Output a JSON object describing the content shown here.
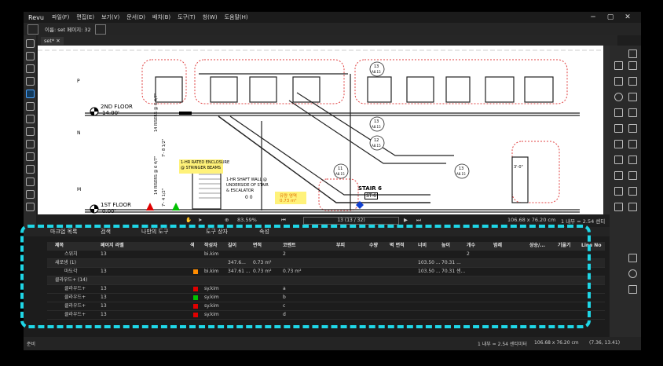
{
  "titlebar": {
    "app": "Revu",
    "menu": [
      "파일(F)",
      "편집(E)",
      "보기(V)",
      "문서(D)",
      "배치(B)",
      "도구(T)",
      "창(W)",
      "도움말(H)"
    ],
    "ctl": [
      "−",
      "▢",
      "✕"
    ]
  },
  "toolbar": {
    "label": "이름: set  페이지: 32"
  },
  "tab": {
    "label": "set*",
    "close": "✕"
  },
  "drawing": {
    "floor2": "2ND FLOOR",
    "floor2_elev": "14.00'",
    "floor1": "1ST FLOOR",
    "floor1_elev": "0.00'",
    "risers1": "14 RISERS @ 6 4/7\"",
    "risers2": "14 RISERS @ 6 4/7\"",
    "dim1": "7'- 8 1/2\"",
    "dim2": "7'- 4 1/2\"",
    "note1a": "1-HR RATED ENCLOSURE",
    "note1b": "@ STRINGER BEAMS",
    "note2a": "1-HR SHAFT WALL @",
    "note2b": "UNDERSIDE OF STAIR",
    "note2c": "& ESCALATOR",
    "area_label": "유량 영역",
    "area_value": "0.73 m²",
    "stair": "STAIR 6",
    "stair_tag": "ST-6",
    "bubbles": [
      {
        "n": "13",
        "s": "A8.15"
      },
      {
        "n": "13",
        "s": "A8.15"
      },
      {
        "n": "12",
        "s": "A8.15"
      },
      {
        "n": "11",
        "s": "A8.15"
      },
      {
        "n": "13",
        "s": "A8.15"
      }
    ],
    "dim3": "3'-0\"",
    "marks": "0  0",
    "grid": [
      "P",
      "N",
      "M"
    ]
  },
  "status": {
    "zoom": "83.59%",
    "page": "13 (13 / 32)",
    "size": "106.68 x 76.20 cm",
    "scale": "1 내부 = 2.54 센티미터"
  },
  "panel": {
    "tabs": [
      "마크업 목록",
      "검색",
      "나만의 도구",
      "도구 상자",
      "속성"
    ],
    "columns": [
      "제목",
      "페이지 라벨",
      "색",
      "작성자",
      "길이",
      "면적",
      "코멘트",
      "부피",
      "수량",
      "벽 면적",
      "너비",
      "높이",
      "개수",
      "범례",
      "상승/...",
      "기울기",
      "Line No"
    ],
    "rows": [
      {
        "type": "item",
        "title": "스위치",
        "page": "13",
        "color": "",
        "author": "bi.kim",
        "len": "",
        "area": "",
        "comment": "2",
        "w": "",
        "h": "",
        "count": "2"
      },
      {
        "type": "group",
        "title": "새로생 (1)",
        "len": "347.6...",
        "area": "0.73 m²",
        "w": "103.50 ...",
        "h": "70.31 ..."
      },
      {
        "type": "item",
        "title": "마도각",
        "page": "13",
        "color": "#ff8c00",
        "author": "bi.kim",
        "len": "347.61 ...",
        "area": "0.73 m²",
        "comment": "0.73 m²",
        "w": "103.50 ...",
        "h": "70.31 센..."
      },
      {
        "type": "group",
        "title": "클라우드+ (14)"
      },
      {
        "type": "item",
        "title": "클라우드+",
        "page": "13",
        "color": "#e00000",
        "author": "sy.kim",
        "comment": "a"
      },
      {
        "type": "item",
        "title": "클라우드+",
        "page": "13",
        "color": "#00c000",
        "author": "sy.kim",
        "comment": "b"
      },
      {
        "type": "item",
        "title": "클라우드+",
        "page": "13",
        "color": "#e00000",
        "author": "sy.kim",
        "comment": "c"
      },
      {
        "type": "item",
        "title": "클라우드+",
        "page": "13",
        "color": "#e00000",
        "author": "sy.kim",
        "comment": "d"
      }
    ]
  },
  "bottom": {
    "left": "준비",
    "scale": "1 내부 = 2.54 센티미터",
    "size": "106.68 x 76.20 cm",
    "coords": "(7.36, 13.41)"
  }
}
